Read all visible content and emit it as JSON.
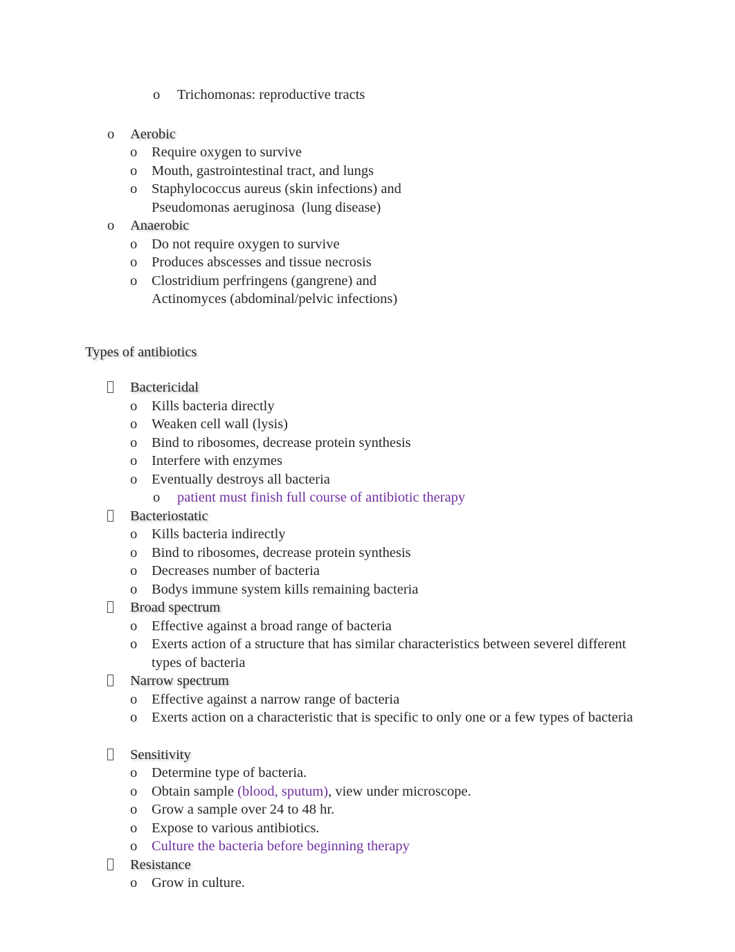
{
  "document": {
    "text_color": "#262626",
    "accent_color": "#7030a0",
    "background_color": "#ffffff"
  },
  "blocks": {
    "trichomonas": "Trichomonas: reproductive tracts",
    "aerobic": {
      "title": "Aerobic",
      "items": [
        "Require oxygen to survive",
        "Mouth, gastrointestinal tract, and lungs"
      ],
      "staph_line1": "Staphylococcus aureus (skin infections) and",
      "staph_line2": "Pseudomonas aeruginosa  (lung disease)"
    },
    "anaerobic": {
      "title": "Anaerobic",
      "items": [
        "Do not require oxygen to survive",
        "Produces abscesses and tissue necrosis"
      ],
      "clostridium_line1": "Clostridium perfringens (gangrene) and",
      "clostridium_line2": "Actinomyces (abdominal/pelvic infections)"
    },
    "section_heading": "Types of antibiotics",
    "bactericidal": {
      "title": "Bactericidal",
      "items": [
        "Kills bacteria directly",
        "Weaken cell wall (lysis)",
        "Bind to ribosomes, decrease protein synthesis",
        "Interfere with enzymes",
        "Eventually destroys all bacteria"
      ],
      "subnote": "patient must finish full course of antibiotic therapy"
    },
    "bacteriostatic": {
      "title": "Bacteriostatic",
      "items": [
        "Kills bacteria indirectly",
        "Bind to ribosomes, decrease protein synthesis",
        "Decreases number of bacteria",
        "Bodys immune system kills remaining bacteria"
      ]
    },
    "broad_spectrum": {
      "title": "Broad spectrum",
      "items": [
        "Effective against a broad range of bacteria"
      ],
      "exerts_line1": "Exerts action of a structure that has similar characteristics between severel different",
      "exerts_line2": "types of bacteria"
    },
    "narrow_spectrum": {
      "title": "Narrow spectrum",
      "items": [
        "Effective against a narrow range of bacteria",
        "Exerts action on a characteristic that is specific to only one or a few types of bacteria"
      ]
    },
    "sensitivity": {
      "title": "Sensitivity",
      "item_determine": "Determine type of bacteria.",
      "obtain_prefix": "Obtain sample ",
      "obtain_purple": "(blood, sputum)",
      "obtain_suffix": ", view under microscope.",
      "item_grow": "Grow a sample over 24 to 48 hr.",
      "item_expose": "Expose to various antibiotics.",
      "item_culture": "Culture the bacteria before beginning therapy"
    },
    "resistance": {
      "title": "Resistance",
      "items": [
        "Grow in culture."
      ]
    }
  },
  "markers": {
    "circle": "o",
    "box": ""
  }
}
